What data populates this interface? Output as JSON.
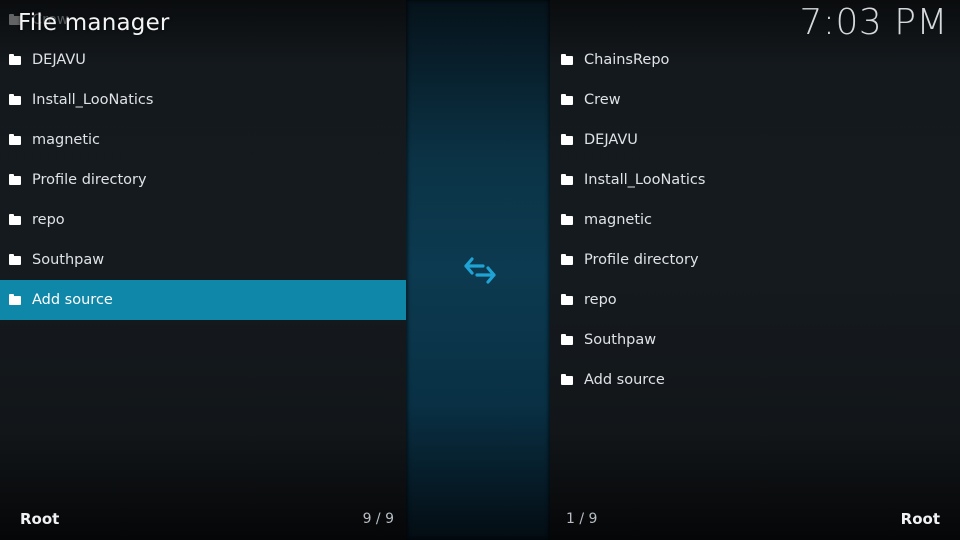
{
  "header": {
    "title": "File manager",
    "clock": "7:03 PM"
  },
  "left_panel": {
    "ghost_item": "Crew",
    "items": [
      {
        "label": "DEJAVU",
        "icon": "folder-icon"
      },
      {
        "label": "Install_LooNatics",
        "icon": "folder-icon"
      },
      {
        "label": "magnetic",
        "icon": "folder-icon"
      },
      {
        "label": "Profile directory",
        "icon": "folder-icon"
      },
      {
        "label": "repo",
        "icon": "folder-icon"
      },
      {
        "label": "Southpaw",
        "icon": "folder-icon"
      },
      {
        "label": "Add source",
        "icon": "folder-icon",
        "selected": true
      }
    ],
    "footer_label": "Root",
    "footer_count": "9 / 9"
  },
  "right_panel": {
    "items": [
      {
        "label": "ChainsRepo",
        "icon": "folder-icon"
      },
      {
        "label": "Crew",
        "icon": "folder-icon"
      },
      {
        "label": "DEJAVU",
        "icon": "folder-icon"
      },
      {
        "label": "Install_LooNatics",
        "icon": "folder-icon"
      },
      {
        "label": "magnetic",
        "icon": "folder-icon"
      },
      {
        "label": "Profile directory",
        "icon": "folder-icon"
      },
      {
        "label": "repo",
        "icon": "folder-icon"
      },
      {
        "label": "Southpaw",
        "icon": "folder-icon"
      },
      {
        "label": "Add source",
        "icon": "folder-icon"
      }
    ],
    "footer_label": "Root",
    "footer_count": "1 / 9"
  },
  "divider": {
    "icon": "swap-arrows-icon",
    "accent_color": "#1fa3d4"
  },
  "colors": {
    "selection": "#0f87a8",
    "background": "#151a1f",
    "divider": "#0c3a50"
  }
}
